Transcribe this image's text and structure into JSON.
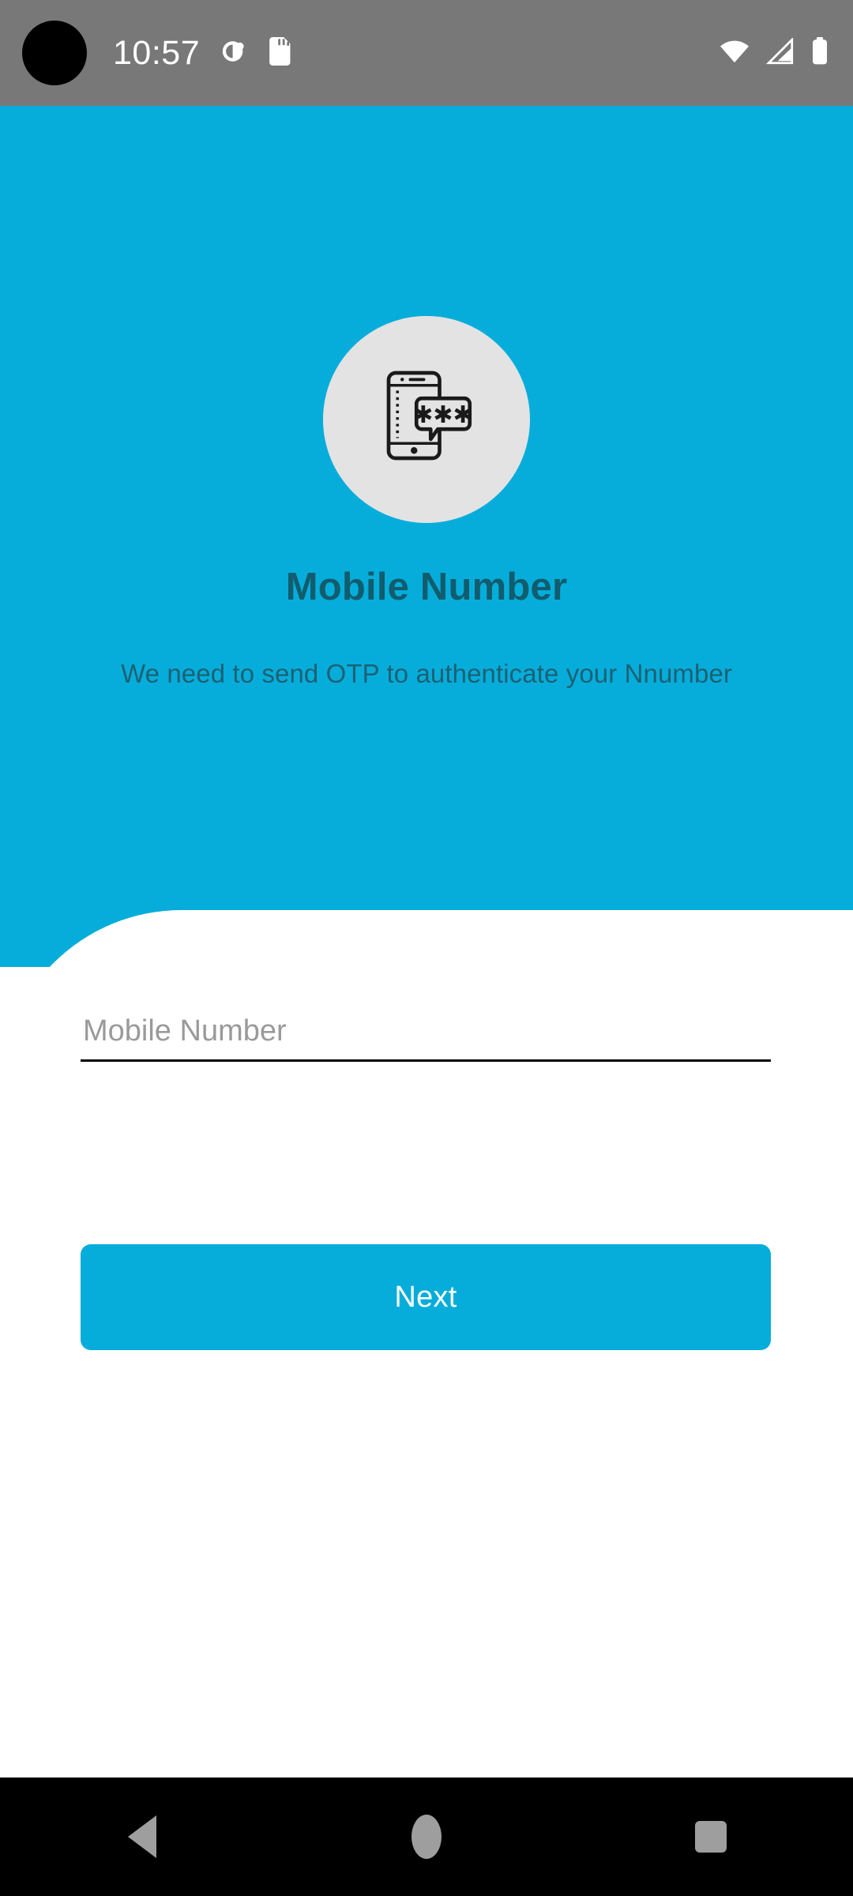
{
  "status_bar": {
    "time": "10:57",
    "camera_cutout_icon": "camera-cutout",
    "notification_icon": "notification-circle-icon",
    "sd_card_icon": "sd-card-icon",
    "wifi_icon": "wifi-icon",
    "signal_icon": "cellular-signal-icon",
    "battery_icon": "battery-full-icon",
    "background_color": "#787878",
    "text_color": "#FFFFFF"
  },
  "hero": {
    "background_color": "#06ADDB",
    "illustration": {
      "icon_name": "phone-otp-message-icon",
      "circle_color": "#E3E3E3",
      "stroke_color": "#1A1A1A",
      "otp_mask": "***"
    },
    "title": "Mobile Number",
    "title_color": "#115C6D",
    "subtitle": "We need to send OTP to authenticate your Nnumber",
    "subtitle_color": "#1C6173"
  },
  "form": {
    "sheet_background": "#FFFFFF",
    "mobile_number_field": {
      "label": "Mobile Number",
      "placeholder": "Mobile Number",
      "value": "",
      "underline_color": "#000000",
      "placeholder_color": "#9A9A9A"
    },
    "next_button": {
      "label": "Next",
      "background_color": "#06ADDB",
      "text_color": "#FFFFFF"
    }
  },
  "navigation_bar": {
    "background_color": "#000000",
    "icon_color": "#9E9E9E",
    "back_icon": "back-triangle-icon",
    "home_icon": "home-circle-icon",
    "recents_icon": "recents-square-icon"
  }
}
